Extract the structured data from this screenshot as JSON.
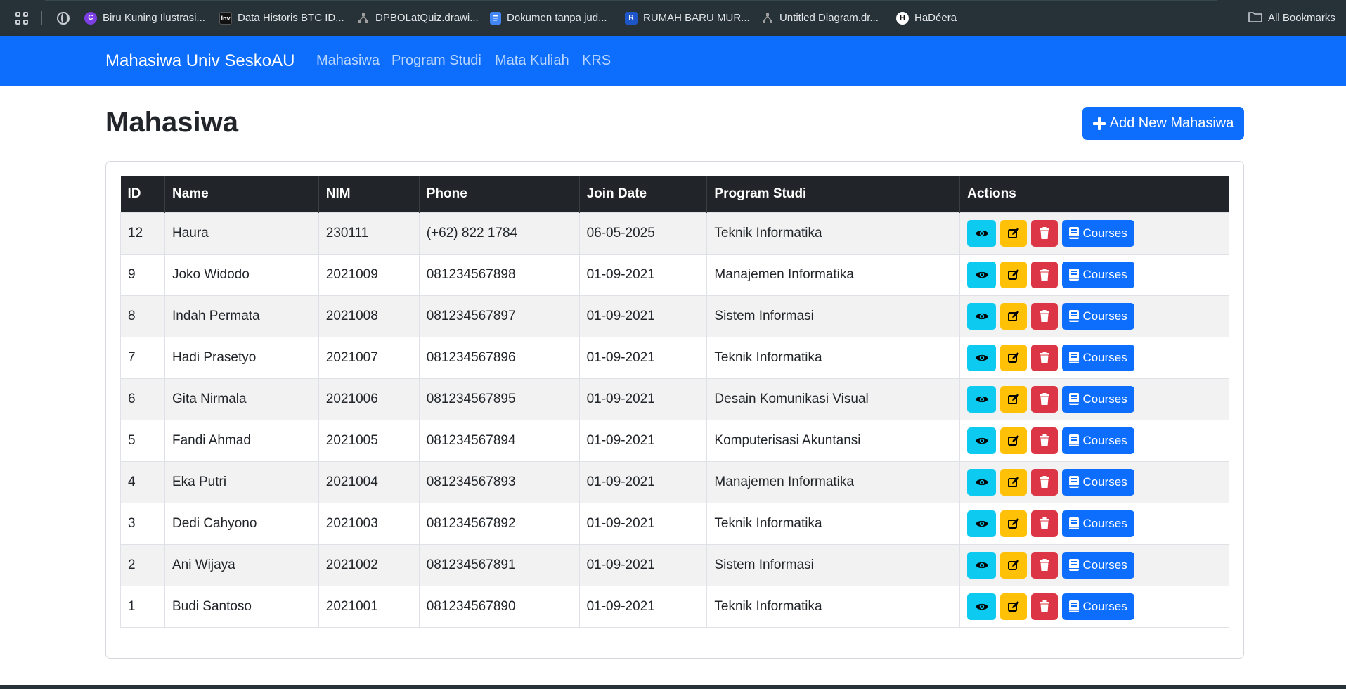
{
  "bookmarks": {
    "items": [
      {
        "label": "Biru Kuning Ilustrasi...",
        "icon": "canva-icon",
        "color": "#7b3fe4"
      },
      {
        "label": "Data Historis BTC ID...",
        "icon": "investing-icon",
        "color": "#111111"
      },
      {
        "label": "DPBOLatQuiz.drawi...",
        "icon": "drawio-icon",
        "color": "#9e9e9e"
      },
      {
        "label": "Dokumen tanpa jud...",
        "icon": "google-docs-icon",
        "color": "#4285f4"
      },
      {
        "label": "RUMAH BARU MUR...",
        "icon": "site-icon",
        "color": "#1e56c8"
      },
      {
        "label": "Untitled Diagram.dr...",
        "icon": "drawio-icon",
        "color": "#9e9e9e"
      },
      {
        "label": "HaDéera",
        "icon": "hadeera-icon",
        "color": "#ffffff"
      }
    ],
    "all_bookmarks": "All Bookmarks"
  },
  "navbar": {
    "brand": "Mahasiwa Univ SeskoAU",
    "links": [
      "Mahasiwa",
      "Program Studi",
      "Mata Kuliah",
      "KRS"
    ]
  },
  "page": {
    "title": "Mahasiwa",
    "add_button": "Add New Mahasiwa"
  },
  "table": {
    "headers": [
      "ID",
      "Name",
      "NIM",
      "Phone",
      "Join Date",
      "Program Studi",
      "Actions"
    ],
    "rows": [
      {
        "id": "12",
        "name": "Haura",
        "nim": "230111",
        "phone": "(+62) 822 1784",
        "join": "06-05-2025",
        "prodi": "Teknik Informatika"
      },
      {
        "id": "9",
        "name": "Joko Widodo",
        "nim": "2021009",
        "phone": "081234567898",
        "join": "01-09-2021",
        "prodi": "Manajemen Informatika"
      },
      {
        "id": "8",
        "name": "Indah Permata",
        "nim": "2021008",
        "phone": "081234567897",
        "join": "01-09-2021",
        "prodi": "Sistem Informasi"
      },
      {
        "id": "7",
        "name": "Hadi Prasetyo",
        "nim": "2021007",
        "phone": "081234567896",
        "join": "01-09-2021",
        "prodi": "Teknik Informatika"
      },
      {
        "id": "6",
        "name": "Gita Nirmala",
        "nim": "2021006",
        "phone": "081234567895",
        "join": "01-09-2021",
        "prodi": "Desain Komunikasi Visual"
      },
      {
        "id": "5",
        "name": "Fandi Ahmad",
        "nim": "2021005",
        "phone": "081234567894",
        "join": "01-09-2021",
        "prodi": "Komputerisasi Akuntansi"
      },
      {
        "id": "4",
        "name": "Eka Putri",
        "nim": "2021004",
        "phone": "081234567893",
        "join": "01-09-2021",
        "prodi": "Manajemen Informatika"
      },
      {
        "id": "3",
        "name": "Dedi Cahyono",
        "nim": "2021003",
        "phone": "081234567892",
        "join": "01-09-2021",
        "prodi": "Teknik Informatika"
      },
      {
        "id": "2",
        "name": "Ani Wijaya",
        "nim": "2021002",
        "phone": "081234567891",
        "join": "01-09-2021",
        "prodi": "Sistem Informasi"
      },
      {
        "id": "1",
        "name": "Budi Santoso",
        "nim": "2021001",
        "phone": "081234567890",
        "join": "01-09-2021",
        "prodi": "Teknik Informatika"
      }
    ],
    "courses_label": "Courses"
  },
  "colors": {
    "primary": "#0d6efd",
    "info": "#0dcaf0",
    "warning": "#ffc107",
    "danger": "#dc3545",
    "dark": "#212529",
    "bookmark_bar": "#263238"
  }
}
